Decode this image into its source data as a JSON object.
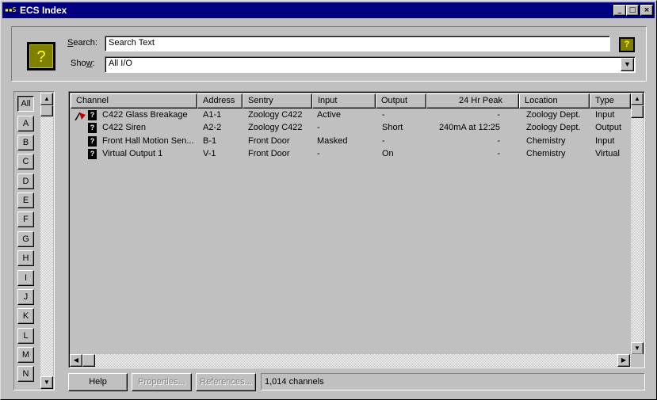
{
  "window": {
    "title": "ECS Index",
    "app_icon": "▪▪S",
    "minimize_glyph": "_",
    "maximize_glyph": "□",
    "close_glyph": "×"
  },
  "filters": {
    "help_glyph": "?",
    "search_label_hotkey": "S",
    "search_label_rest": "earch:",
    "search_value": "Search Text",
    "show_label_prefix": "Sho",
    "show_label_hotkey": "w",
    "show_label_suffix": ":",
    "show_value": "All I/O",
    "dropdown_glyph": "▼"
  },
  "letters": [
    "All",
    "A",
    "B",
    "C",
    "D",
    "E",
    "F",
    "G",
    "H",
    "I",
    "J",
    "K",
    "L",
    "M",
    "N"
  ],
  "active_letter": "All",
  "scroll": {
    "up": "▲",
    "down": "▼",
    "left": "◀",
    "right": "▶"
  },
  "table": {
    "columns": [
      "Channel",
      "Address",
      "Sentry",
      "Input",
      "Output",
      "24 Hr Peak",
      "Location",
      "Type"
    ],
    "status_icon": "?",
    "rows": [
      {
        "alarm": true,
        "channel": "C422 Glass Breakage",
        "address": "A1-1",
        "sentry": "Zoology C422",
        "input": "Active",
        "output": "-",
        "peak": "-",
        "location": "Zoology Dept.",
        "type": "Input"
      },
      {
        "alarm": false,
        "channel": "C422 Siren",
        "address": "A2-2",
        "sentry": "Zoology C422",
        "input": "-",
        "output": "Short",
        "peak": "240mA at 12:25",
        "location": "Zoology Dept.",
        "type": "Output"
      },
      {
        "alarm": false,
        "channel": "Front Hall Motion Sen...",
        "address": "B-1",
        "sentry": "Front Door",
        "input": "Masked",
        "output": "-",
        "peak": "-",
        "location": "Chemistry",
        "type": "Input"
      },
      {
        "alarm": false,
        "channel": "Virtual Output 1",
        "address": "V-1",
        "sentry": "Front Door",
        "input": "-",
        "output": "On",
        "peak": "-",
        "location": "Chemistry",
        "type": "Virtual"
      }
    ]
  },
  "buttons": {
    "help": "Help",
    "properties": "Properties...",
    "references": "References..."
  },
  "status_text": "1,014 channels",
  "colors": {
    "titlebar": "#000080",
    "alarm_flag": "#c00000",
    "help_bg": "#808000",
    "help_fg": "#ffff00"
  }
}
